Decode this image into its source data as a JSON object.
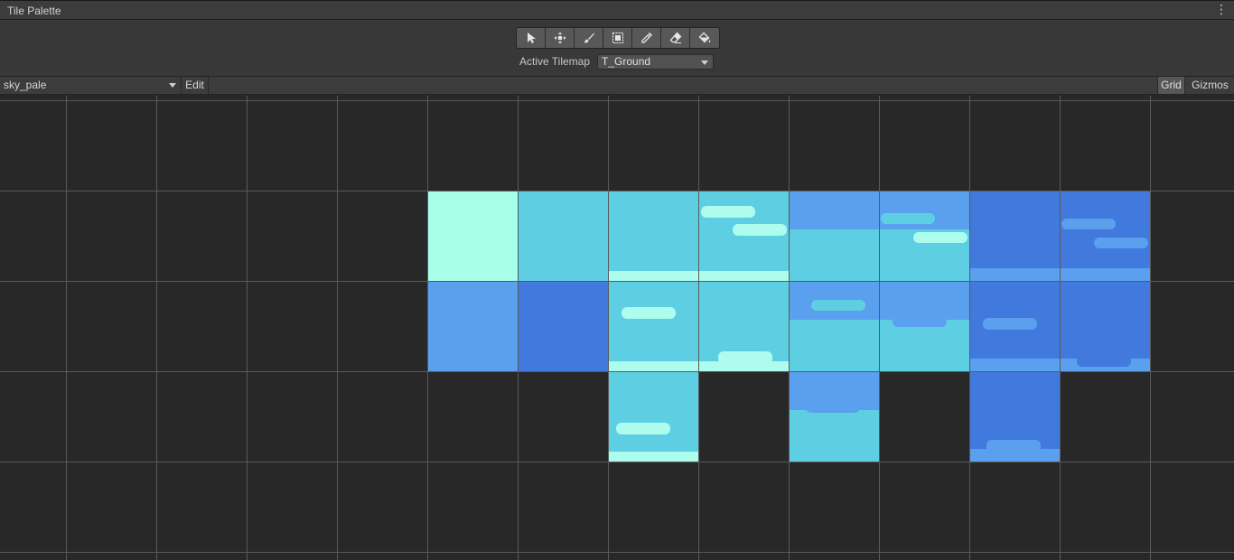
{
  "window": {
    "title": "Tile Palette",
    "menu_icon": "kebab-menu-icon"
  },
  "toolbar": {
    "tools": [
      {
        "name": "select-tool",
        "icon": "arrow-cursor-icon"
      },
      {
        "name": "move-tool",
        "icon": "move-arrows-icon"
      },
      {
        "name": "paint-tool",
        "icon": "brush-icon"
      },
      {
        "name": "box-fill-tool",
        "icon": "box-fill-icon"
      },
      {
        "name": "picker-tool",
        "icon": "eyedropper-icon"
      },
      {
        "name": "erase-tool",
        "icon": "eraser-icon"
      },
      {
        "name": "flood-fill-tool",
        "icon": "paint-bucket-icon"
      }
    ],
    "active_tilemap_label": "Active Tilemap",
    "active_tilemap_value": "T_Ground"
  },
  "palette_bar": {
    "palette_name": "sky_pale",
    "edit_label": "Edit",
    "grid_label": "Grid",
    "gizmos_label": "Gizmos"
  },
  "colors": {
    "mint": "#a8ffea",
    "cyan": "#5ecfe2",
    "blue_light": "#5aa0ee",
    "blue_dark": "#4279dc",
    "cloud": "#aefcee",
    "cloud_blue": "#7cc6f2",
    "grid_line": "#5a5a5a",
    "background": "#282828"
  }
}
